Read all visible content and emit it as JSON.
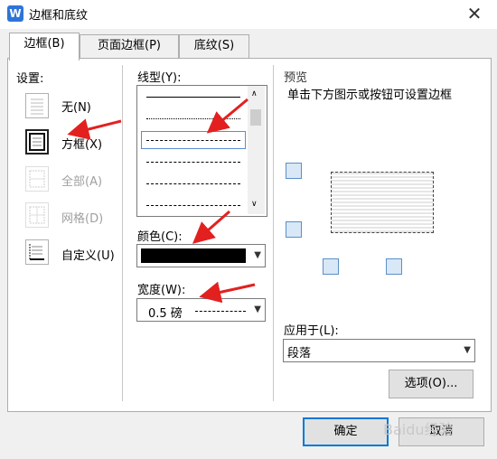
{
  "window": {
    "title": "边框和底纹",
    "app_icon": "W"
  },
  "tabs": [
    {
      "label": "边框(B)"
    },
    {
      "label": "页面边框(P)"
    },
    {
      "label": "底纹(S)"
    }
  ],
  "settings": {
    "heading": "设置:",
    "items": [
      {
        "label": "无(N)",
        "enabled": true
      },
      {
        "label": "方框(X)",
        "enabled": true,
        "selected": true
      },
      {
        "label": "全部(A)",
        "enabled": false
      },
      {
        "label": "网格(D)",
        "enabled": false
      },
      {
        "label": "自定义(U)",
        "enabled": true
      }
    ]
  },
  "line_style": {
    "heading": "线型(Y):",
    "options": [
      "solid",
      "dotted",
      "dashed-fine",
      "dashed",
      "dash-dot",
      "dash-dot-dot"
    ],
    "selected_index": 2
  },
  "color": {
    "heading": "颜色(C):",
    "value": "#000000"
  },
  "width": {
    "heading": "宽度(W):",
    "value": "0.5  磅"
  },
  "preview": {
    "heading": "预览",
    "hint": "单击下方图示或按钮可设置边框"
  },
  "apply_to": {
    "heading": "应用于(L):",
    "value": "段落"
  },
  "buttons": {
    "options": "选项(O)...",
    "ok": "确定",
    "cancel": "取消"
  },
  "watermark": "Baidu经验"
}
